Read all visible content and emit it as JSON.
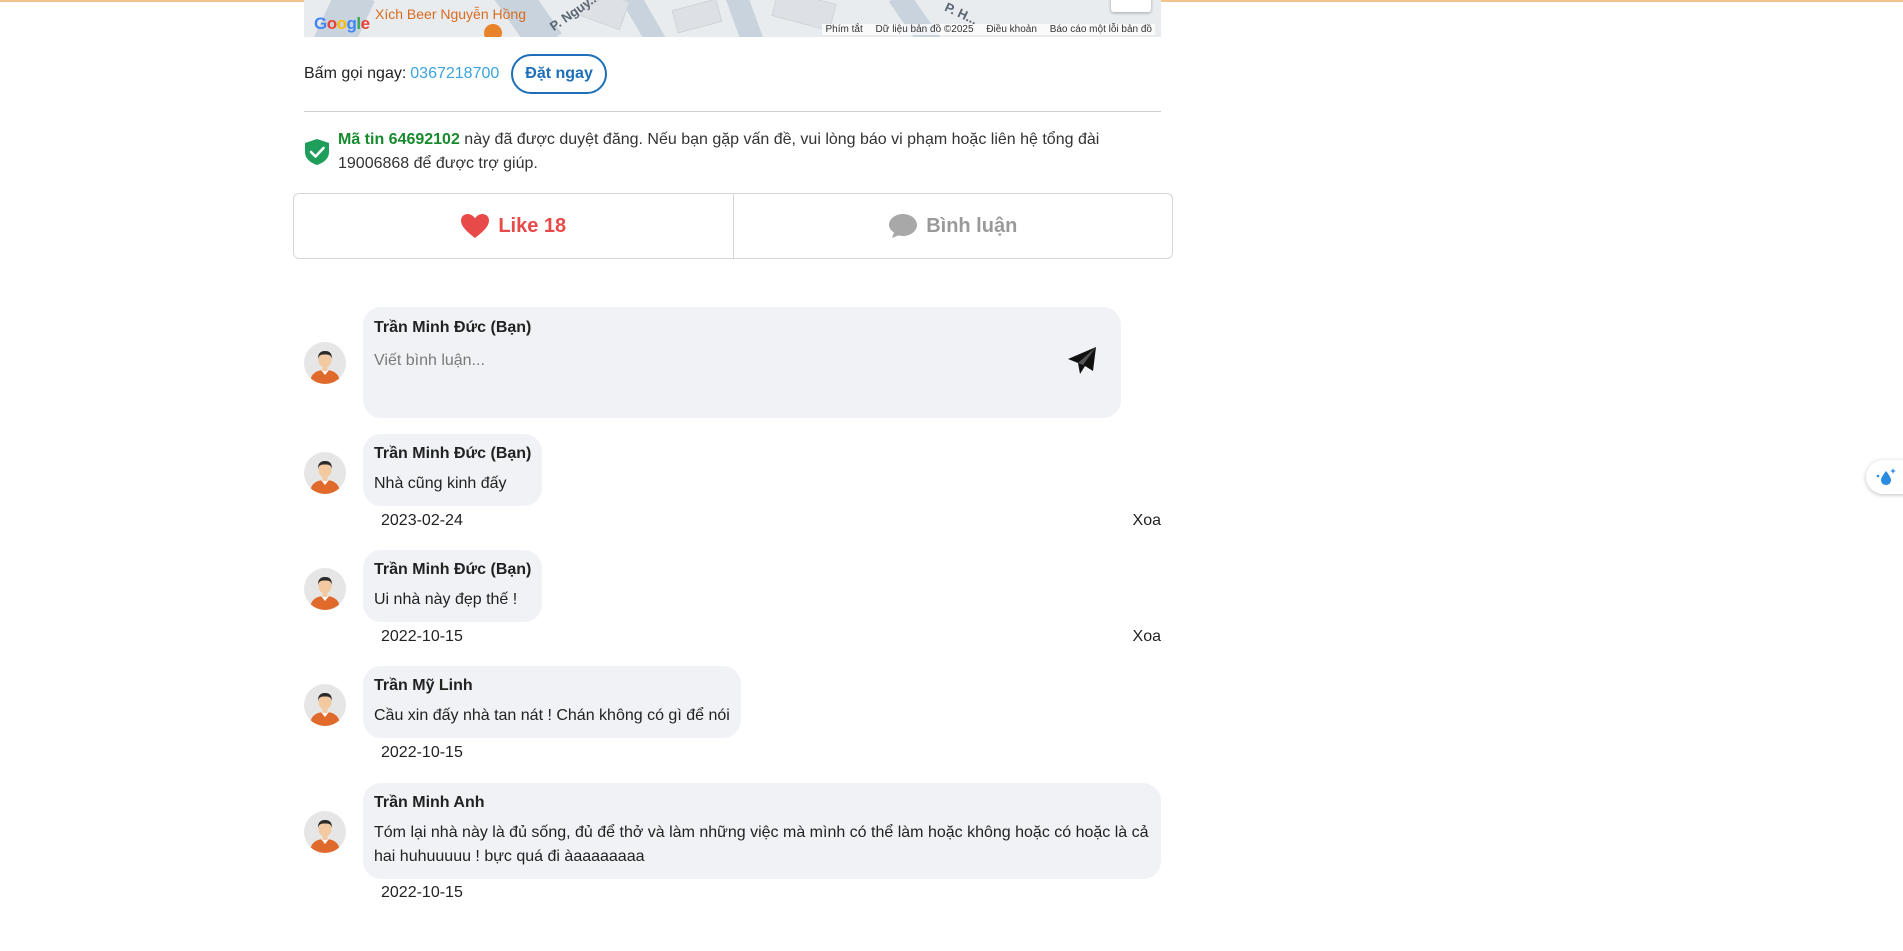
{
  "map": {
    "google_logo": "Google",
    "poi_label": "Xích Beer Nguyễn Hồng",
    "streets": [
      "P. Nguy...",
      "P. H..."
    ],
    "attribution": [
      "Phím tắt",
      "Dữ liệu bản đồ ©2025",
      "Điều khoản",
      "Báo cáo một lỗi bản đồ"
    ]
  },
  "contact": {
    "call_label": "Bấm gọi ngay:",
    "phone": "0367218700",
    "book_button": "Đặt ngay"
  },
  "notice": {
    "code_label": "Mã tin 64692102",
    "text": " này đã được duyệt đăng. Nếu bạn gặp vấn đề, vui lòng báo vi phạm hoặc liên hệ tổng đài 19006868 để được trợ giúp."
  },
  "actions": {
    "like_label": "Like 18",
    "comment_label": "Bình luận",
    "like_color": "#e84a4a",
    "comment_color": "#9a9a9a"
  },
  "composer": {
    "user_name": "Trần Minh Đức (Bạn)",
    "placeholder": "Viết bình luận..."
  },
  "comments": [
    {
      "name": "Trần Minh Đức (Bạn)",
      "text": "Nhà cũng kinh đấy",
      "date": "2023-02-24",
      "delete_label": "Xoa"
    },
    {
      "name": "Trần Minh Đức (Bạn)",
      "text": "Ui nhà này đẹp thế !",
      "date": "2022-10-15",
      "delete_label": "Xoa"
    },
    {
      "name": "Trần Mỹ Linh",
      "text": "Cầu xin đấy nhà tan nát ! Chán không có gì để nói",
      "date": "2022-10-15"
    },
    {
      "name": "Trần Minh Anh",
      "text": "Tóm lại nhà này là đủ sống, đủ để thở và làm những việc mà mình có thể làm hoặc không hoặc có hoặc là cả hai huhuuuuu ! bực quá đi àaaaaaaaa",
      "date": "2022-10-15"
    }
  ]
}
